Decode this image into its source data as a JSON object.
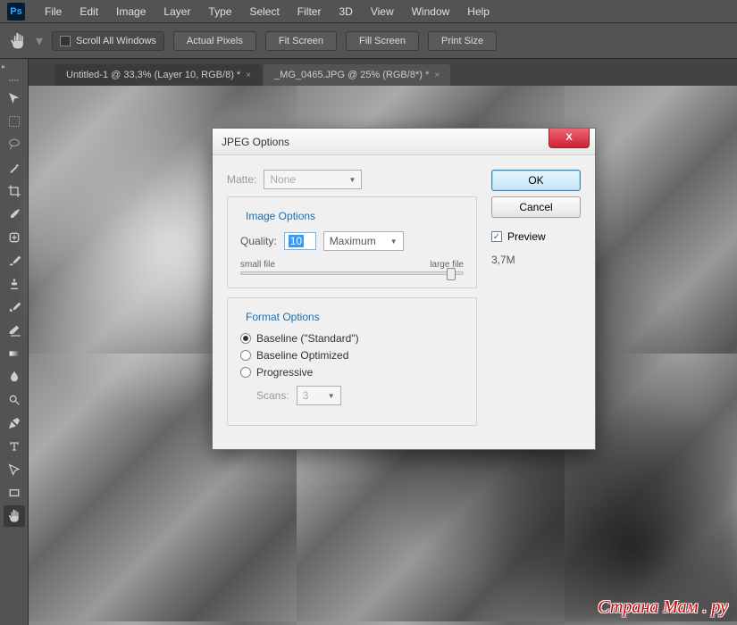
{
  "app": {
    "logo": "Ps"
  },
  "menu": [
    "File",
    "Edit",
    "Image",
    "Layer",
    "Type",
    "Select",
    "Filter",
    "3D",
    "View",
    "Window",
    "Help"
  ],
  "optbar": {
    "scroll_all": "Scroll All Windows",
    "buttons": [
      "Actual Pixels",
      "Fit Screen",
      "Fill Screen",
      "Print Size"
    ]
  },
  "tabs": [
    {
      "label": "Untitled-1 @ 33,3% (Layer 10, RGB/8) *",
      "active": false
    },
    {
      "label": "_MG_0465.JPG @ 25% (RGB/8*) *",
      "active": true
    }
  ],
  "tools": [
    "move",
    "marquee",
    "lasso",
    "magic-wand",
    "crop",
    "eyedropper",
    "healing",
    "brush",
    "stamp",
    "history-brush",
    "eraser",
    "gradient",
    "blur",
    "dodge",
    "pen",
    "type",
    "path-select",
    "rectangle",
    "hand"
  ],
  "dialog": {
    "title": "JPEG Options",
    "matte_label": "Matte:",
    "matte_value": "None",
    "image_options": {
      "legend": "Image Options",
      "quality_label": "Quality:",
      "quality_value": "10",
      "quality_preset": "Maximum",
      "small": "small file",
      "large": "large file"
    },
    "format_options": {
      "legend": "Format Options",
      "baseline_std": "Baseline (\"Standard\")",
      "baseline_opt": "Baseline Optimized",
      "progressive": "Progressive",
      "scans_label": "Scans:",
      "scans_value": "3"
    },
    "ok": "OK",
    "cancel": "Cancel",
    "preview": "Preview",
    "size": "3,7M"
  },
  "watermark": "Страна Мам . ру"
}
